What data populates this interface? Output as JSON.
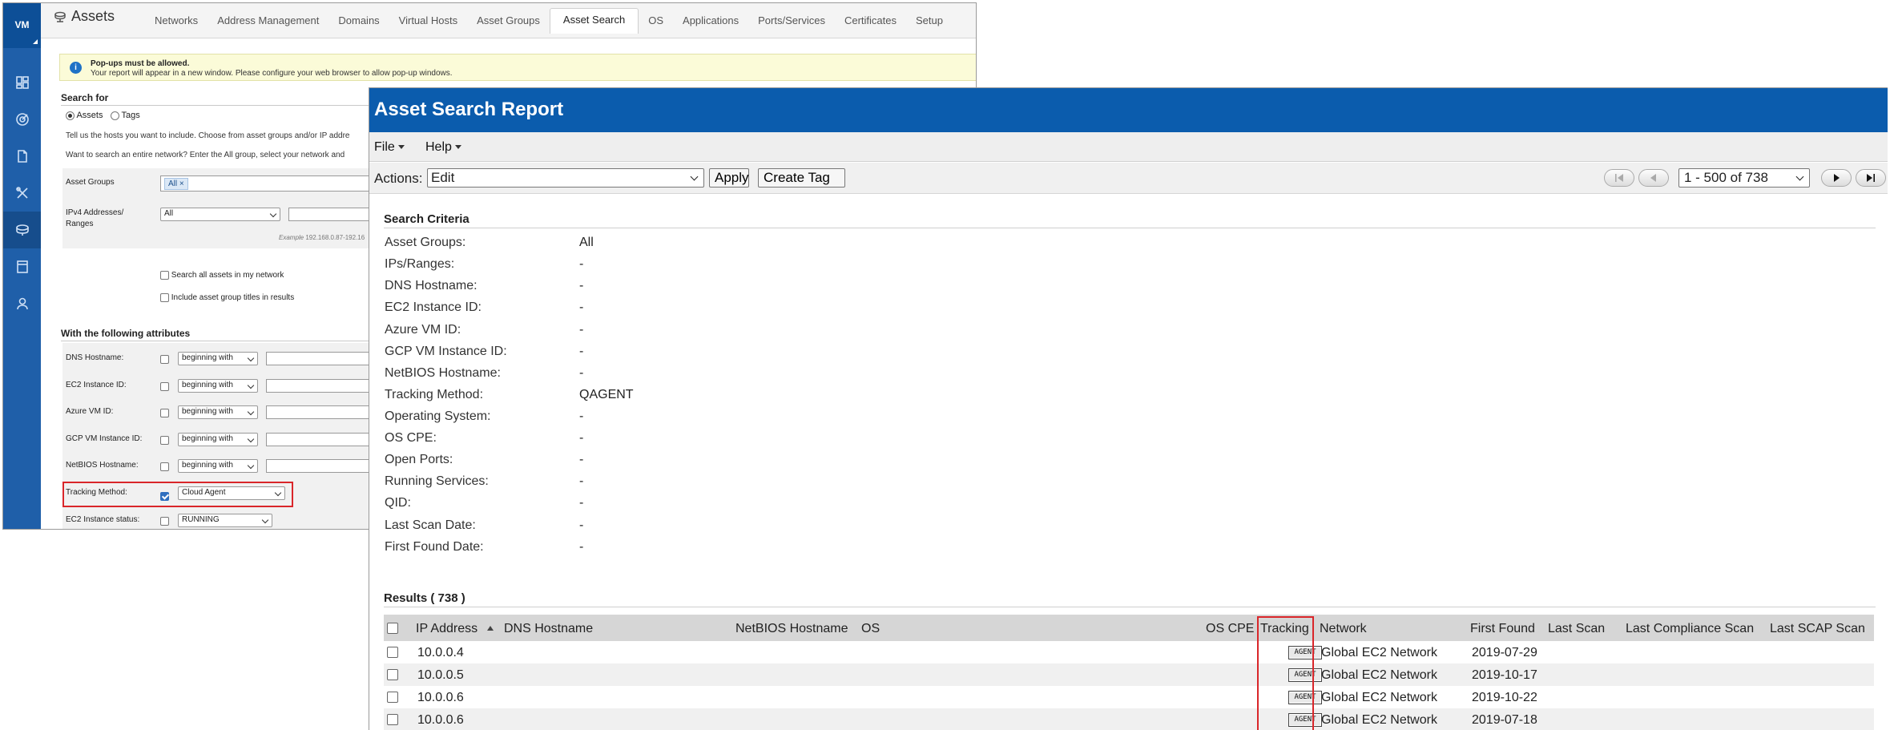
{
  "assets_window": {
    "logo": "VM",
    "title": "Assets",
    "tabs": [
      "Networks",
      "Address Management",
      "Domains",
      "Virtual Hosts",
      "Asset Groups",
      "Asset Search",
      "OS",
      "Applications",
      "Ports/Services",
      "Certificates",
      "Setup"
    ],
    "active_tab": "Asset Search",
    "popup_notice": {
      "title": "Pop-ups must be allowed.",
      "text": "Your report will appear in a new window. Please configure your web browser to allow pop-up windows."
    },
    "search_for": {
      "heading": "Search for",
      "radio_assets": "Assets",
      "radio_tags": "Tags",
      "help_line_1": "Tell us the hosts you want to include. Choose from asset groups and/or IP addre",
      "help_line_2": "Want to search an entire network? Enter the All group, select your network and",
      "asset_groups_label": "Asset Groups",
      "asset_groups_chip": "All ×",
      "ipv4_label_1": "IPv4 Addresses/",
      "ipv4_label_2": "Ranges",
      "ipv4_select": "All",
      "example_label": "Example",
      "example_value": "192.168.0.87-192.16",
      "search_all_label": "Search all assets in my network",
      "include_titles_label": "Include asset group titles in results"
    },
    "attributes": {
      "heading": "With the following attributes",
      "rows": [
        {
          "label": "DNS Hostname:",
          "select": "beginning with"
        },
        {
          "label": "EC2 Instance ID:",
          "select": "beginning with"
        },
        {
          "label": "Azure VM ID:",
          "select": "beginning with"
        },
        {
          "label": "GCP VM Instance ID:",
          "select": "beginning with"
        },
        {
          "label": "NetBIOS Hostname:",
          "select": "beginning with"
        }
      ],
      "tracking_label": "Tracking Method:",
      "tracking_select": "Cloud Agent",
      "ec2_status_label": "EC2 Instance status:",
      "ec2_status_select": "RUNNING"
    }
  },
  "report": {
    "title": "Asset Search Report",
    "menu": {
      "file": "File",
      "help": "Help"
    },
    "actions_label": "Actions:",
    "actions_value": "Edit",
    "apply_label": "Apply",
    "create_tag_label": "Create Tag",
    "pager_value": "1 - 500 of 738",
    "criteria_heading": "Search Criteria",
    "criteria": [
      {
        "label": "Asset Groups:",
        "value": "All"
      },
      {
        "label": "IPs/Ranges:",
        "value": "-"
      },
      {
        "label": "DNS Hostname:",
        "value": "-"
      },
      {
        "label": "EC2 Instance ID:",
        "value": "-"
      },
      {
        "label": "Azure VM ID:",
        "value": "-"
      },
      {
        "label": "GCP VM Instance ID:",
        "value": "-"
      },
      {
        "label": "NetBIOS Hostname:",
        "value": "-"
      },
      {
        "label": "Tracking Method:",
        "value": "QAGENT"
      },
      {
        "label": "Operating System:",
        "value": "-"
      },
      {
        "label": "OS CPE:",
        "value": "-"
      },
      {
        "label": "Open Ports:",
        "value": "-"
      },
      {
        "label": "Running Services:",
        "value": "-"
      },
      {
        "label": "QID:",
        "value": "-"
      },
      {
        "label": "Last Scan Date:",
        "value": "-"
      },
      {
        "label": "First Found Date:",
        "value": "-"
      }
    ],
    "results_heading": "Results ( 738 )",
    "columns": {
      "ip": "IP Address",
      "dns": "DNS Hostname",
      "netbios": "NetBIOS Hostname",
      "os": "OS",
      "os_cpe": "OS CPE",
      "tracking": "Tracking",
      "network": "Network",
      "first_found": "First Found",
      "last_scan": "Last Scan",
      "last_compliance": "Last Compliance Scan",
      "last_scap": "Last SCAP Scan"
    },
    "rows": [
      {
        "ip": "10.0.0.4",
        "tracking": "AGENT",
        "network": "Global EC2 Network",
        "first_found": "2019-07-29"
      },
      {
        "ip": "10.0.0.5",
        "tracking": "AGENT",
        "network": "Global EC2 Network",
        "first_found": "2019-10-17"
      },
      {
        "ip": "10.0.0.6",
        "tracking": "AGENT",
        "network": "Global EC2 Network",
        "first_found": "2019-10-22"
      },
      {
        "ip": "10.0.0.6",
        "tracking": "AGENT",
        "network": "Global EC2 Network",
        "first_found": "2019-07-18"
      }
    ]
  },
  "colors": {
    "rail": "#1f5fa9",
    "report_header": "#0b5cad",
    "highlight": "#d9262a"
  }
}
